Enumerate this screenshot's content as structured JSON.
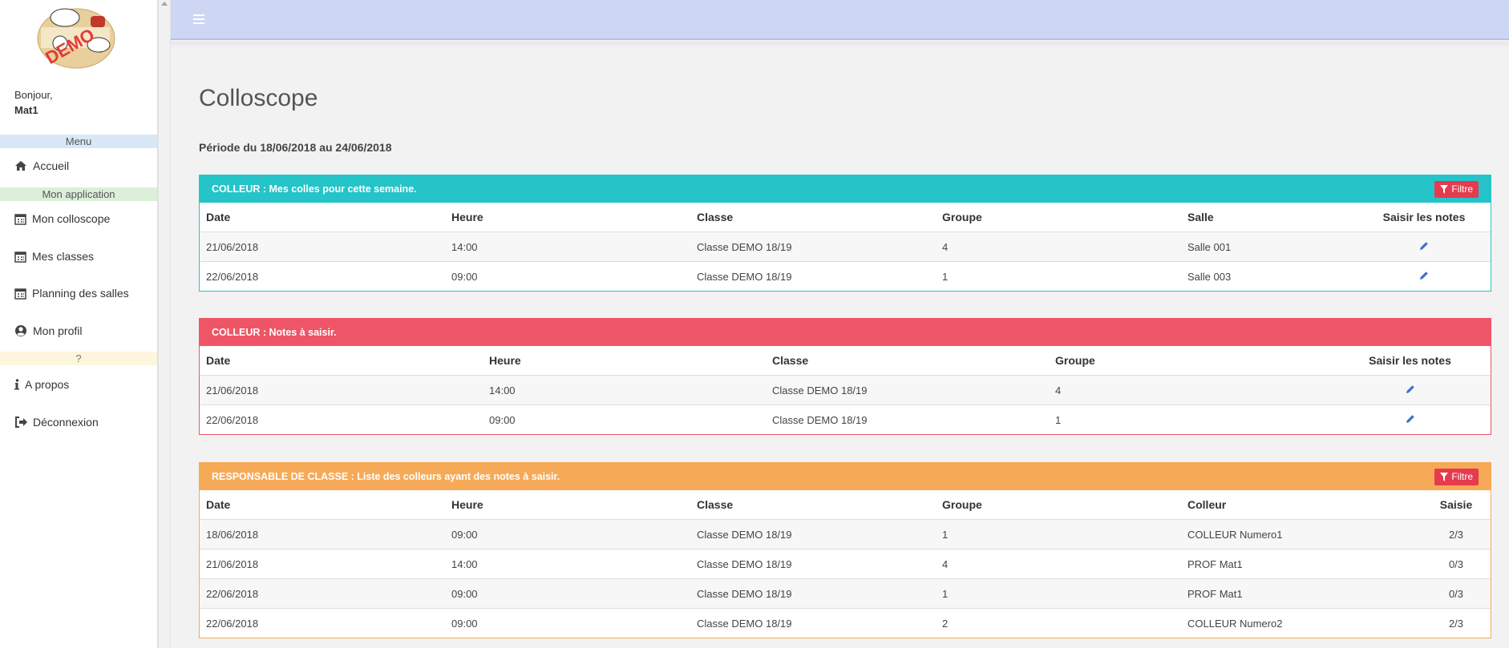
{
  "colors": {
    "topbar": "#cdd7f4",
    "panel1": "#24c4c9",
    "panel2": "#ee5566",
    "panel3": "#f6a957",
    "menu_section": "#d8e8f6",
    "app_section": "#dcefd9",
    "help_section": "#fdf5dd"
  },
  "sidebar": {
    "greeting": "Bonjour,",
    "username": "Mat1",
    "sections": {
      "menu": "Menu",
      "app": "Mon application",
      "help": "?"
    },
    "items": [
      {
        "label": "Accueil",
        "icon": "home-icon"
      },
      {
        "label": "Mon colloscope",
        "icon": "calendar-icon"
      },
      {
        "label": "Mes classes",
        "icon": "calendar-icon"
      },
      {
        "label": "Planning des salles",
        "icon": "calendar-icon"
      },
      {
        "label": "Mon profil",
        "icon": "user-circle-icon"
      },
      {
        "label": "A propos",
        "icon": "info-icon"
      },
      {
        "label": "Déconnexion",
        "icon": "sign-out-icon"
      }
    ]
  },
  "main": {
    "title": "Colloscope",
    "periode": "Période du 18/06/2018 au 24/06/2018",
    "filter_label": "Filtre",
    "panels": [
      {
        "title": "COLLEUR : Mes colles pour cette semaine.",
        "headers": [
          "Date",
          "Heure",
          "Classe",
          "Groupe",
          "Salle",
          "Saisir les notes"
        ],
        "rows": [
          [
            "21/06/2018",
            "14:00",
            "Classe DEMO 18/19",
            "4",
            "Salle 001"
          ],
          [
            "22/06/2018",
            "09:00",
            "Classe DEMO 18/19",
            "1",
            "Salle 003"
          ]
        ]
      },
      {
        "title": "COLLEUR : Notes à saisir.",
        "headers": [
          "Date",
          "Heure",
          "Classe",
          "Groupe",
          "Saisir les notes"
        ],
        "rows": [
          [
            "21/06/2018",
            "14:00",
            "Classe DEMO 18/19",
            "4"
          ],
          [
            "22/06/2018",
            "09:00",
            "Classe DEMO 18/19",
            "1"
          ]
        ]
      },
      {
        "title": "RESPONSABLE DE CLASSE : Liste des colleurs ayant des notes à saisir.",
        "headers": [
          "Date",
          "Heure",
          "Classe",
          "Groupe",
          "Colleur",
          "Saisie"
        ],
        "rows": [
          [
            "18/06/2018",
            "09:00",
            "Classe DEMO 18/19",
            "1",
            "COLLEUR Numero1",
            "2/3"
          ],
          [
            "21/06/2018",
            "14:00",
            "Classe DEMO 18/19",
            "4",
            "PROF Mat1",
            "0/3"
          ],
          [
            "22/06/2018",
            "09:00",
            "Classe DEMO 18/19",
            "1",
            "PROF Mat1",
            "0/3"
          ],
          [
            "22/06/2018",
            "09:00",
            "Classe DEMO 18/19",
            "2",
            "COLLEUR Numero2",
            "2/3"
          ]
        ]
      }
    ]
  }
}
